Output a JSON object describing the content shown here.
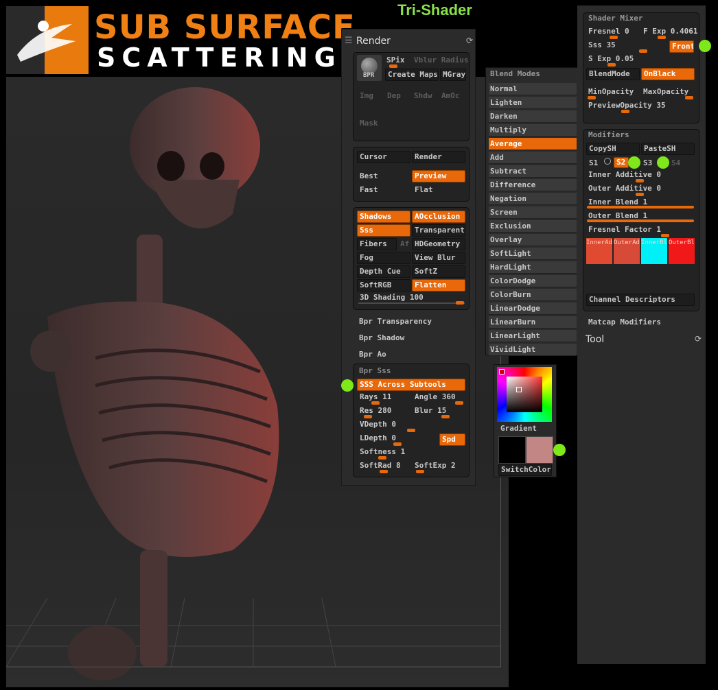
{
  "header": {
    "title_line1": "SUB SURFACE",
    "title_line2": "SCATTERING",
    "subtitle": "Tri-Shader"
  },
  "render": {
    "title": "Render",
    "bpr": "BPR",
    "spix": "SPix",
    "vblur": "Vblur Radius",
    "create_maps": "Create Maps",
    "mgray": "MGray",
    "img": "Img",
    "dep": "Dep",
    "shdw": "Shdw",
    "amoc": "AmOc",
    "mask": "Mask",
    "cursor": "Cursor",
    "render_btn": "Render",
    "best": "Best",
    "preview": "Preview",
    "fast": "Fast",
    "flat": "Flat",
    "shadows": "Shadows",
    "aocclusion": "AOcclusion",
    "sss": "Sss",
    "transparent": "Transparent",
    "fibers": "Fibers",
    "af": "Af",
    "hdgeometry": "HDGeometry",
    "fog": "Fog",
    "view_blur": "View Blur",
    "depth_cue": "Depth Cue",
    "softz": "SoftZ",
    "softrgb": "SoftRGB",
    "flatten": "Flatten",
    "shading": "3D Shading 100",
    "bpr_transparency": "Bpr Transparency",
    "bpr_shadow": "Bpr Shadow",
    "bpr_ao": "Bpr Ao",
    "bpr_sss": "Bpr Sss",
    "sss_across": "SSS Across Subtools",
    "rays": "Rays 11",
    "angle": "Angle 360",
    "res": "Res 280",
    "blur": "Blur 15",
    "vdepth": "VDepth 0",
    "ldepth": "LDepth 0",
    "spd": "Spd",
    "softness": "Softness 1",
    "softrad": "SoftRad 8",
    "softexp": "SoftExp 2"
  },
  "blend": {
    "title": "Blend Modes",
    "items": [
      "Normal",
      "Lighten",
      "Darken",
      "Multiply",
      "Average",
      "Add",
      "Subtract",
      "Difference",
      "Negation",
      "Screen",
      "Exclusion",
      "Overlay",
      "SoftLight",
      "HardLight",
      "ColorDodge",
      "ColorBurn",
      "LinearDodge",
      "LinearBurn",
      "LinearLight",
      "VividLight"
    ],
    "selected": "Average"
  },
  "color": {
    "gradient": "Gradient",
    "switch": "SwitchColor",
    "main_color": "#000000",
    "secondary_color": "#c28685"
  },
  "mixer": {
    "title": "Shader Mixer",
    "fresnel": "Fresnel 0",
    "fexp": "F Exp 0.4061",
    "sss": "Sss 35",
    "front": "Front",
    "sexp": "S Exp 0.05",
    "blendmode": "BlendMode",
    "onblack": "OnBlack",
    "minop": "MinOpacity",
    "maxop": "MaxOpacity",
    "preview_op": "PreviewOpacity 35"
  },
  "modifiers": {
    "title": "Modifiers",
    "copysh": "CopySH",
    "pastesh": "PasteSH",
    "s1": "S1",
    "s2": "S2",
    "s3": "S3",
    "s4": "S4",
    "inner_add": "Inner Additive 0",
    "outer_add": "Outer Additive 0",
    "inner_blend": "Inner Blend 1",
    "outer_blend": "Outer Blend 1",
    "fresnel_factor": "Fresnel Factor 1",
    "swatches": [
      {
        "label": "InnerAdd",
        "color": "#e04a30"
      },
      {
        "label": "OuterAdd",
        "color": "#d84a38"
      },
      {
        "label": "InnerBle",
        "color": "#00f0f8"
      },
      {
        "label": "OuterBle",
        "color": "#f01818"
      }
    ],
    "channel": "Channel Descriptors",
    "matcap": "Matcap Modifiers",
    "tool": "Tool"
  }
}
